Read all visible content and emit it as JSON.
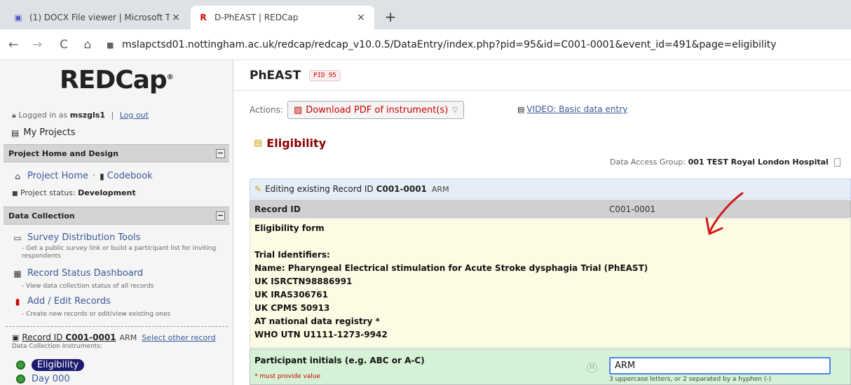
{
  "browser": {
    "tabs": [
      {
        "title": "(1) DOCX File viewer | Microsoft T",
        "close": "×",
        "favicon": "teams-icon"
      },
      {
        "title": "D-PhEAST | REDCap",
        "close": "×",
        "favicon": "redcap-icon"
      }
    ],
    "new_tab": "+",
    "nav": {
      "back": "←",
      "forward": "→",
      "reload": "C",
      "home": "⌂"
    },
    "url": "mslapctsd01.nottingham.ac.uk/redcap/redcap_v10.0.5/DataEntry/index.php?pid=95&id=C001-0001&event_id=491&page=eligibility"
  },
  "sidebar": {
    "logo": "REDCap",
    "logo_reg": "®",
    "login": {
      "prefix": "Logged in as",
      "user": "mszgls1",
      "sep": "|",
      "logout": "Log out"
    },
    "my_projects": "My Projects",
    "sections": {
      "project_home": {
        "title": "Project Home and Design",
        "collapse": "−",
        "project_home_link": "Project Home",
        "dot_sep": "·",
        "codebook_link": "Codebook",
        "status_label": "Project status:",
        "status_value": "Development"
      },
      "data_collection": {
        "title": "Data Collection",
        "collapse": "−",
        "items": [
          {
            "label": "Survey Distribution Tools",
            "desc": "- Get a public survey link or build a participant list for inviting respondents"
          },
          {
            "label": "Record Status Dashboard",
            "desc": "- View data collection status of all records"
          },
          {
            "label": "Add / Edit Records",
            "desc": "- Create new records or edit/view existing ones"
          }
        ]
      }
    },
    "record": {
      "prefix": "Record ID",
      "id": "C001-0001",
      "arm": "ARM",
      "select_other": "Select other record"
    },
    "instruments_label": "Data Collection Instruments:",
    "instruments": [
      "Eligibility",
      "Day 000"
    ]
  },
  "main": {
    "project_title": "PhEAST",
    "pid": "PID 95",
    "actions_label": "Actions:",
    "download_pdf": "Download PDF of instrument(s)",
    "video_link": "VIDEO: Basic data entry",
    "form_title": "Eligibility",
    "dag_label": "Data Access Group:",
    "dag_value": "001 TEST Royal London Hospital",
    "edit_bar": {
      "prefix": "Editing existing Record ID",
      "id": "C001-0001",
      "arm": "ARM"
    },
    "record_row": {
      "label": "Record ID",
      "value": "C001-0001"
    },
    "description_lines": [
      "Eligibility form",
      "Trial Identifiers:",
      "Name: Pharyngeal Electrical stimulation for Acute Stroke dysphagia Trial (PhEAST)",
      "UK ISRCTN98886991",
      "UK IRAS306761",
      "UK CPMS 50913",
      "AT national data registry *",
      "WHO UTN U1111-1273-9942"
    ],
    "field": {
      "label": "Participant initials (e.g. ABC or A-C)",
      "required": "* must provide value",
      "history": "H",
      "value": "ARM",
      "note": "3 uppercase letters, or 2 separated by a hyphen (-)"
    }
  },
  "colors": {
    "accent": "#800000",
    "link": "#3b5998",
    "field_bg": "#d6f2d6",
    "desc_bg": "#fcfce4",
    "annotation": "#d01c1c"
  }
}
